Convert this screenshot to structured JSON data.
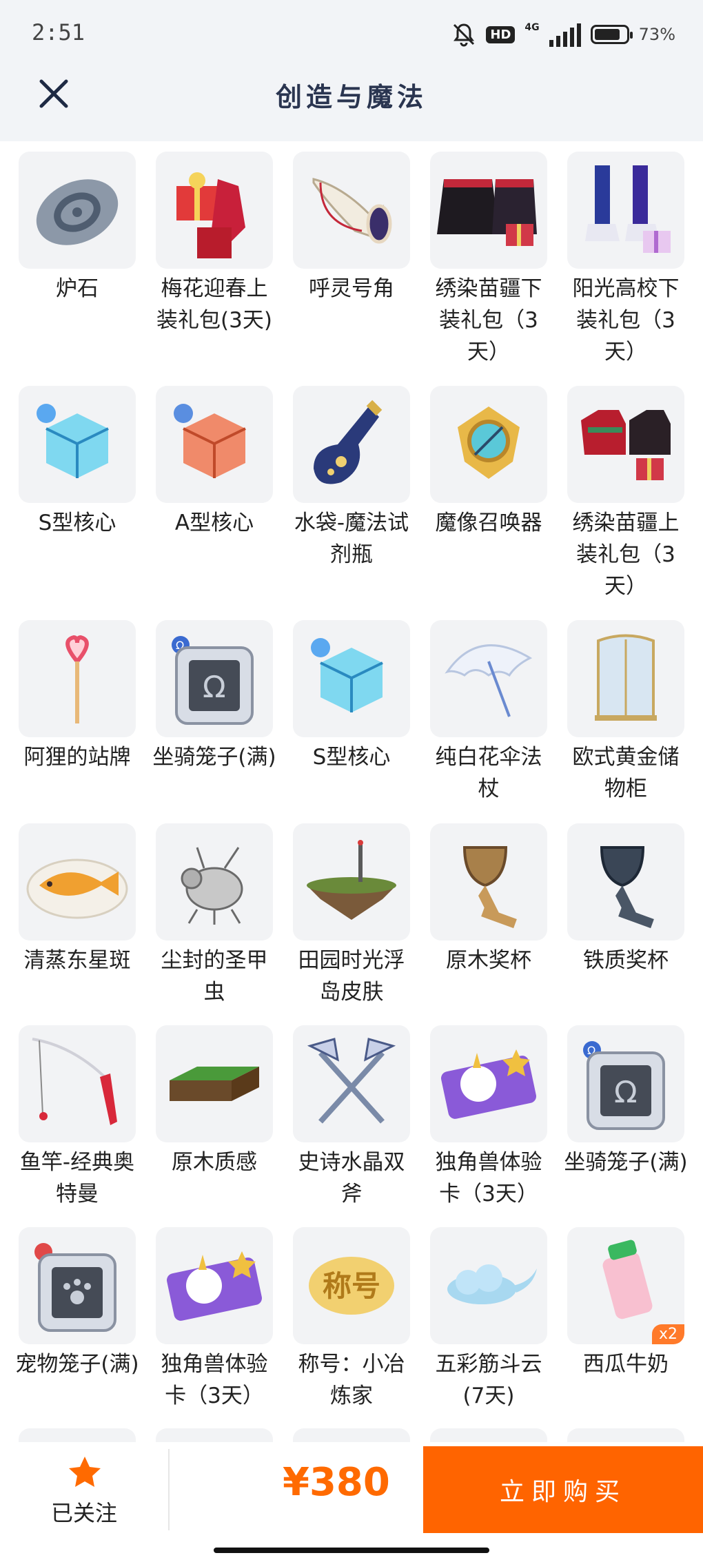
{
  "status_bar": {
    "time": "2:51",
    "network": "4G",
    "hd": "HD",
    "battery": "73%"
  },
  "header": {
    "title": "创造与魔法"
  },
  "items": [
    {
      "name": "炉石"
    },
    {
      "name": "梅花迎春上装礼包(3天)"
    },
    {
      "name": "呼灵号角"
    },
    {
      "name": "绣染苗疆下装礼包（3天）"
    },
    {
      "name": "阳光高校下装礼包（3天）"
    },
    {
      "name": "S型核心"
    },
    {
      "name": "A型核心"
    },
    {
      "name": "水袋-魔法试剂瓶"
    },
    {
      "name": "魔像召唤器"
    },
    {
      "name": "绣染苗疆上装礼包（3天）"
    },
    {
      "name": "阿狸的站牌"
    },
    {
      "name": "坐骑笼子(满)"
    },
    {
      "name": "S型核心"
    },
    {
      "name": "纯白花伞法杖"
    },
    {
      "name": "欧式黄金储物柜"
    },
    {
      "name": "清蒸东星斑"
    },
    {
      "name": "尘封的圣甲虫"
    },
    {
      "name": "田园时光浮岛皮肤"
    },
    {
      "name": "原木奖杯"
    },
    {
      "name": "铁质奖杯"
    },
    {
      "name": "鱼竿-经典奥特曼"
    },
    {
      "name": "原木质感"
    },
    {
      "name": "史诗水晶双斧"
    },
    {
      "name": "独角兽体验卡（3天）"
    },
    {
      "name": "坐骑笼子(满)"
    },
    {
      "name": "宠物笼子(满)"
    },
    {
      "name": "独角兽体验卡（3天）"
    },
    {
      "name": "称号：小冶炼家",
      "thumb_text": "称号"
    },
    {
      "name": "五彩筋斗云(7天)"
    },
    {
      "name": "西瓜牛奶",
      "qty": "x2"
    }
  ],
  "footer": {
    "follow_label": "已关注",
    "price": "¥380",
    "buy_label": "立即购买"
  },
  "colors": {
    "accent": "#ff6400",
    "price": "#ff6a00",
    "title": "#2a3550"
  }
}
